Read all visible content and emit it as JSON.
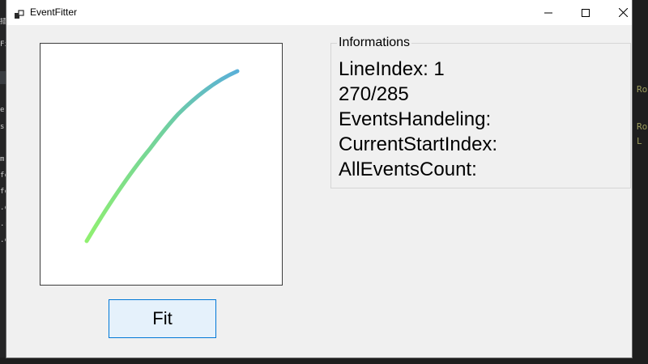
{
  "window": {
    "title": "EventFitter"
  },
  "fit_button": {
    "label": "Fit"
  },
  "informations": {
    "title": "Informations",
    "lines": [
      "LineIndex: 1",
      "270/285",
      "EventsHandeling:",
      "CurrentStartIndex:",
      "AllEventsCount:"
    ]
  },
  "background": {
    "left_glyphs": [
      "插",
      "Fi",
      "e",
      "s",
      "m",
      "fc",
      "fc",
      ".c",
      ".r",
      ".c"
    ],
    "right_glyphs": [
      "Ro",
      "Ro",
      "L"
    ]
  },
  "colors": {
    "curve_start": "#90f070",
    "curve_end": "#5ab0d8",
    "button_bg": "#e5f1fb",
    "button_border": "#0078d7"
  }
}
